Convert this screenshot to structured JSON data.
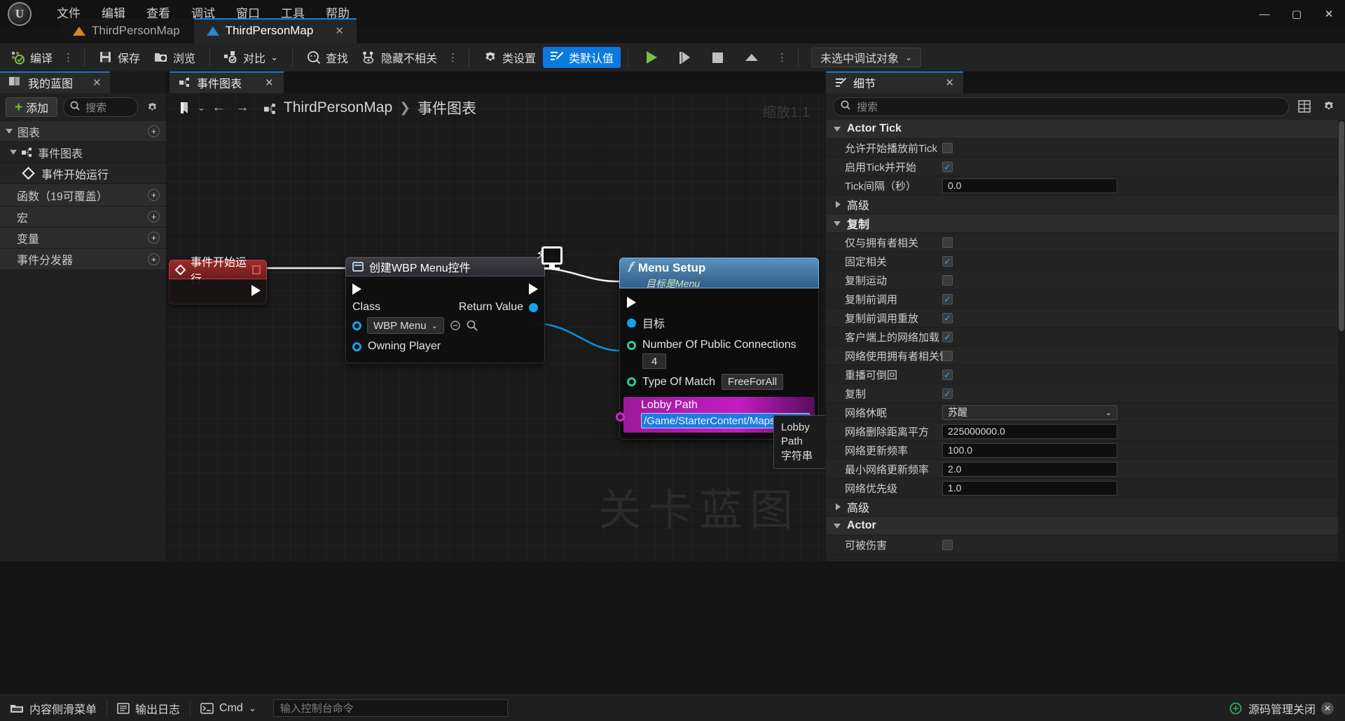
{
  "app": {
    "logo": "ue-logo",
    "menus": [
      "文件",
      "编辑",
      "查看",
      "调试",
      "窗口",
      "工具",
      "帮助"
    ],
    "window_buttons": {
      "minimize": "—",
      "maximize": "▢",
      "close": "✕"
    }
  },
  "tabs": [
    {
      "label": "ThirdPersonMap",
      "icon": "level-icon-orange",
      "active": false,
      "close": "✕"
    },
    {
      "label": "ThirdPersonMap",
      "icon": "blueprint-icon-blue",
      "active": true,
      "close": "✕"
    }
  ],
  "toolbar": {
    "compile": "编译",
    "save": "保存",
    "browse": "浏览",
    "diff": "对比",
    "find": "查找",
    "hide_unrelated": "隐藏不相关",
    "class_settings": "类设置",
    "class_defaults": "类默认值",
    "dots": "⋮",
    "chevron": "⌄",
    "play": "play-icon",
    "step": "step-icon",
    "stop": "stop-icon",
    "eject": "eject-icon",
    "debug_object": "未选中调试对象"
  },
  "sidebar": {
    "title": "我的蓝图",
    "close": "✕",
    "add_label": "添加",
    "add_plus": "+",
    "search_placeholder": "搜索",
    "gear": "gear-icon",
    "rows": [
      {
        "label": "图表",
        "type": "group",
        "expanded": true,
        "add": "+"
      },
      {
        "label": "事件图表",
        "type": "sub",
        "expanded": true,
        "add": ""
      },
      {
        "label": "事件开始运行",
        "type": "leaf",
        "add": ""
      },
      {
        "label": "函数（19可覆盖）",
        "type": "group-flat",
        "add": "+"
      },
      {
        "label": "宏",
        "type": "group-flat",
        "add": "+"
      },
      {
        "label": "变量",
        "type": "group-flat",
        "add": "+"
      },
      {
        "label": "事件分发器",
        "type": "group-flat",
        "add": "+"
      }
    ]
  },
  "graph": {
    "tab_label": "事件图表",
    "tab_close": "✕",
    "nav": {
      "bookmark": "bookmark-icon",
      "chevron": "⌄",
      "back": "←",
      "forward": "→"
    },
    "breadcrumb": {
      "root": "ThirdPersonMap",
      "separator": "❯",
      "current": "事件图表"
    },
    "zoom_label": "缩放1:1",
    "watermark": "关卡蓝图",
    "nodes": {
      "event_begin_play": {
        "title": "事件开始运行",
        "icon": "event-diamond-icon"
      },
      "create_widget": {
        "title": "创建WBP Menu控件",
        "class_label": "Class",
        "class_value": "WBP Menu",
        "return_label": "Return Value",
        "owning_player_label": "Owning Player"
      },
      "menu_setup": {
        "title": "Menu Setup",
        "subtitle": "目标是Menu",
        "target_label": "目标",
        "connections_label": "Number Of Public Connections",
        "connections_value": "4",
        "match_label": "Type Of Match",
        "match_value": "FreeForAll",
        "lobby_label": "Lobby Path",
        "lobby_value": "/Game/StarterContent/Maps/StarterMap"
      }
    },
    "tooltip": {
      "line1": "Lobby Path",
      "line2": "字符串"
    }
  },
  "details": {
    "title": "细节",
    "close": "✕",
    "search_placeholder": "搜索",
    "grid_icon": "grid-view-icon",
    "gear_icon": "settings-icon",
    "sections": [
      {
        "name": "Actor Tick",
        "expanded": true,
        "rows": [
          {
            "label": "允许开始播放前Tick",
            "type": "checkbox",
            "value": false
          },
          {
            "label": "启用Tick并开始",
            "type": "checkbox",
            "value": true
          },
          {
            "label": "Tick间隔（秒）",
            "type": "text",
            "value": "0.0"
          }
        ],
        "sub": {
          "label": "高级",
          "expanded": false
        }
      },
      {
        "name": "复制",
        "expanded": true,
        "rows": [
          {
            "label": "仅与拥有者相关",
            "type": "checkbox",
            "value": false
          },
          {
            "label": "固定相关",
            "type": "checkbox",
            "value": true
          },
          {
            "label": "复制运动",
            "type": "checkbox",
            "value": false
          },
          {
            "label": "复制前调用",
            "type": "checkbox",
            "value": true
          },
          {
            "label": "复制前调用重放",
            "type": "checkbox",
            "value": true
          },
          {
            "label": "客户端上的网络加载",
            "type": "checkbox",
            "value": true
          },
          {
            "label": "网络使用拥有者相关性",
            "type": "checkbox",
            "value": false
          },
          {
            "label": "重播可倒回",
            "type": "checkbox",
            "value": true
          },
          {
            "label": "复制",
            "type": "checkbox",
            "value": true
          },
          {
            "label": "网络休眠",
            "type": "select",
            "value": "苏醒"
          },
          {
            "label": "网络删除距离平方",
            "type": "text",
            "value": "225000000.0"
          },
          {
            "label": "网络更新频率",
            "type": "text",
            "value": "100.0"
          },
          {
            "label": "最小网络更新频率",
            "type": "text",
            "value": "2.0"
          },
          {
            "label": "网络优先级",
            "type": "text",
            "value": "1.0"
          }
        ],
        "sub": {
          "label": "高级",
          "expanded": false
        }
      },
      {
        "name": "Actor",
        "expanded": true,
        "rows": [
          {
            "label": "可被伤害",
            "type": "checkbox",
            "value": false
          }
        ],
        "sub": null
      }
    ]
  },
  "statusbar": {
    "content_drawer": "内容侧滑菜单",
    "output_log": "输出日志",
    "cmd_label": "Cmd",
    "cmd_chevron": "⌄",
    "cmd_placeholder": "输入控制台命令",
    "source_control": "源码管理关闭"
  }
}
